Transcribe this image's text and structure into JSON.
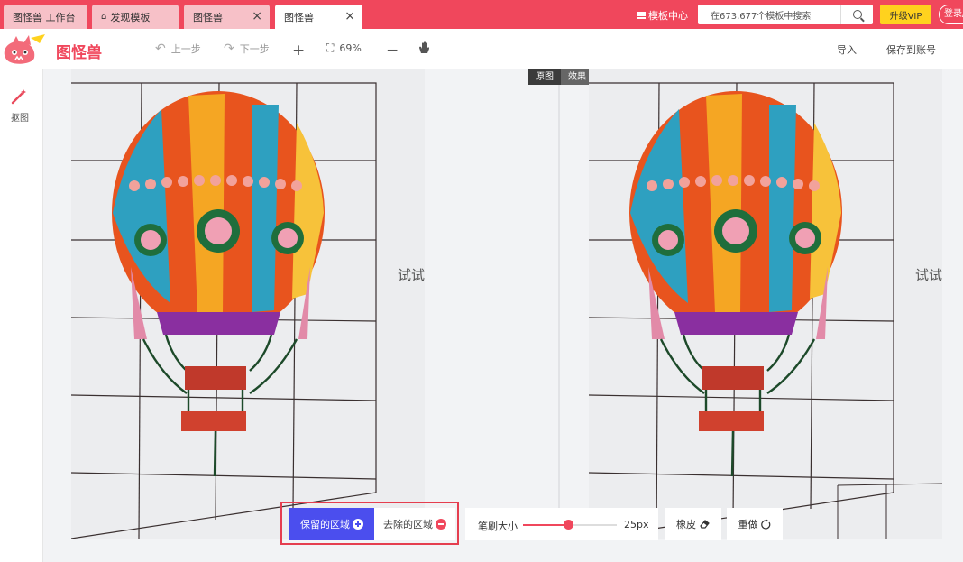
{
  "tabs": [
    {
      "label": "图怪兽  工作台"
    },
    {
      "label": "发现模板"
    },
    {
      "label": "图怪兽"
    },
    {
      "label": "图怪兽"
    }
  ],
  "header": {
    "template_center": "模板中心",
    "search_placeholder": "在673,677个模板中搜索",
    "vip": "升级VIP",
    "login": "登录/"
  },
  "brand": {
    "logo_text": "图怪兽"
  },
  "toolbar": {
    "undo": "上一步",
    "redo": "下一步",
    "zoom": "69%",
    "import": "导入",
    "save": "保存到账号"
  },
  "side": {
    "cutout": "抠图"
  },
  "view_toggle": {
    "original": "原图",
    "effect": "效果"
  },
  "canvas": {
    "side_text": "试试"
  },
  "controls": {
    "keep": "保留的区域",
    "remove": "去除的区域",
    "brush_label": "笔刷大小",
    "brush_value": "25px",
    "brush_fraction": 0.49,
    "eraser": "橡皮",
    "redo": "重做"
  },
  "colors": {
    "brand": "#f0475c",
    "keep": "#4b4eee",
    "vip": "#ffd21e"
  }
}
